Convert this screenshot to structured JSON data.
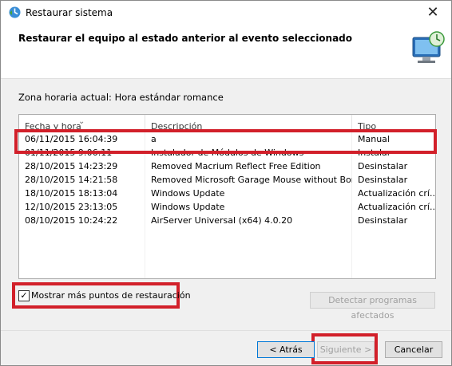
{
  "window": {
    "title": "Restaurar sistema",
    "close_glyph": "✕"
  },
  "header": {
    "title": "Restaurar el equipo al estado anterior al evento seleccionado"
  },
  "timezone_label": "Zona horaria actual: Hora estándar romance",
  "table": {
    "columns": [
      "Fecha y hora",
      "Descripción",
      "Tipo"
    ],
    "rows": [
      [
        "06/11/2015 16:04:39",
        "a",
        "Manual"
      ],
      [
        "01/11/2015 9:06:11",
        "Instalador de Módulos de Windows",
        "Instalar"
      ],
      [
        "28/10/2015 14:23:29",
        "Removed Macrium Reflect Free Edition",
        "Desinstalar"
      ],
      [
        "28/10/2015 14:21:58",
        "Removed Microsoft Garage Mouse without Borders",
        "Desinstalar"
      ],
      [
        "18/10/2015 18:13:04",
        "Windows Update",
        "Actualización crí..."
      ],
      [
        "12/10/2015 23:13:05",
        "Windows Update",
        "Actualización crí..."
      ],
      [
        "08/10/2015 10:24:22",
        "AirServer Universal (x64) 4.0.20",
        "Desinstalar"
      ]
    ],
    "selected_row": 0
  },
  "checkbox": {
    "label": "Mostrar más puntos de restauración",
    "checked": true,
    "glyph": "✓"
  },
  "buttons": {
    "detect": "Detectar programas afectados",
    "back": "< Atrás",
    "next": "Siguiente >",
    "cancel": "Cancelar"
  },
  "colors": {
    "highlight": "#d2202a",
    "focus": "#0078d7"
  }
}
